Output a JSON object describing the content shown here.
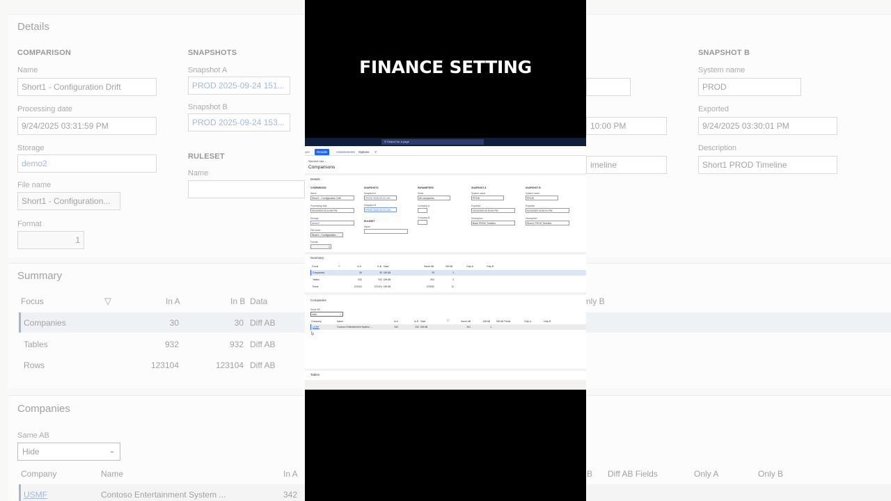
{
  "caption": "FINANCE SETTING",
  "search": {
    "placeholder": "Search for a page"
  },
  "tabs": [
    "Share",
    "Results",
    "Assessments",
    "Options"
  ],
  "view": "Standard view",
  "page_title": "Comparisons",
  "details": {
    "header": "Details",
    "comparison": {
      "title": "COMPARISON",
      "name_label": "Name",
      "name": "Short1 - Configuration Drift",
      "date_label": "Processing date",
      "date": "9/24/2025 03:31:59 PM",
      "storage_label": "Storage",
      "storage": "demo2",
      "file_label": "File name",
      "file": "Short1 - Configuration...",
      "format_label": "Format",
      "format": "1"
    },
    "snapshots": {
      "title": "SNAPSHOTS",
      "a_label": "Snapshot A",
      "a": "PROD 2025-09-24 151...",
      "b_label": "Snapshot B",
      "b": "PROD 2025-09-24 153..."
    },
    "ruleset": {
      "title": "RULESET",
      "name_label": "Name"
    },
    "parameters": {
      "title": "PARAMETERS",
      "mode_label": "Mode",
      "mode": "All companies",
      "ca_label": "Company A",
      "cb_label": "Company B"
    },
    "snapshot_a": {
      "title": "SNAPSHOT A",
      "sys_label": "System name",
      "sys": "PROD",
      "exp_label": "Exported",
      "exp": "9/24/2025 03:10:00 PM",
      "desc_label": "Description",
      "desc": "Base PROD Timeline"
    },
    "snapshot_b": {
      "title": "SNAPSHOT B",
      "sys_label": "System name",
      "sys": "PROD",
      "exp_label": "Exported",
      "exp": "9/24/2025 03:30:01 PM",
      "desc_label": "Description",
      "desc": "Short1 PROD Timeline"
    }
  },
  "summary": {
    "header": "Summary",
    "columns": [
      "Focus",
      "In A",
      "In B",
      "Data",
      "Same AB",
      "Diff AB",
      "Only A",
      "Only B"
    ],
    "rows": [
      {
        "focus": "Companies",
        "in_a": "30",
        "in_b": "30",
        "data": "Diff AB",
        "same": "29",
        "diff": "1"
      },
      {
        "focus": "Tables",
        "in_a": "932",
        "in_b": "932",
        "data": "Diff AB",
        "same": "904",
        "diff": "3"
      },
      {
        "focus": "Rows",
        "in_a": "123104",
        "in_b": "123104",
        "data": "Diff AB",
        "same": "123092",
        "diff": "12"
      }
    ]
  },
  "companies": {
    "header": "Companies",
    "same_label": "Same AB",
    "same_value": "Hide",
    "columns": [
      "Company",
      "Name",
      "In A",
      "In B",
      "Data",
      "Same AB",
      "Diff AB",
      "Diff AB Fields",
      "Only A",
      "Only B"
    ],
    "rows": [
      {
        "company": "USMF",
        "name": "Contoso Entertainment System ...",
        "in_a": "342",
        "in_b": "342",
        "data": "Diff AB",
        "same": "341",
        "diff": "1"
      }
    ]
  },
  "tables": {
    "header": "Tables"
  },
  "background": {
    "details": "Details",
    "comparison": "COMPARISON",
    "snapshots": "SNAPSHOTS",
    "snapshot_b": "SNAPSHOT B",
    "name_label": "Name",
    "name": "Short1 - Configuration Drift",
    "date_label": "Processing date",
    "date": "9/24/2025 03:31:59 PM",
    "storage_label": "Storage",
    "storage": "demo2",
    "file_label": "File name",
    "file": "Short1 - Configuration...",
    "format_label": "Format",
    "format": "1",
    "snap_a_label": "Snapshot A",
    "snap_a": "PROD 2025-09-24 151...",
    "snap_b_label": "Snapshot B",
    "snap_b": "PROD 2025-09-24 153...",
    "ruleset": "RULESET",
    "ruleset_name": "Name",
    "sys_label": "System name",
    "sys": "PROD",
    "exp_label": "Exported",
    "exp": "9/24/2025 03:30:01 PM",
    "desc_label": "Description",
    "desc": "Short1 PROD Timeline",
    "exp_a_fragment": "10:00 PM",
    "desc_a_fragment": "imeline",
    "summary": "Summary",
    "focus": "Focus",
    "in_a": "In A",
    "in_b": "In B",
    "data": "Data",
    "only_b_fragment": "nly B",
    "r1": [
      "Companies",
      "30",
      "30",
      "Diff AB"
    ],
    "r2": [
      "Tables",
      "932",
      "932",
      "Diff AB"
    ],
    "r3": [
      "Rows",
      "123104",
      "123104",
      "Diff AB"
    ],
    "companies": "Companies",
    "same_label": "Same AB",
    "same_value": "Hide",
    "company": "Company",
    "name_col": "Name",
    "b_fragment": "B",
    "diff_fields": "Diff AB Fields",
    "only_a": "Only A",
    "only_b": "Only B",
    "c1": [
      "USMF",
      "Contoso Entertainment System ...",
      "342"
    ]
  }
}
